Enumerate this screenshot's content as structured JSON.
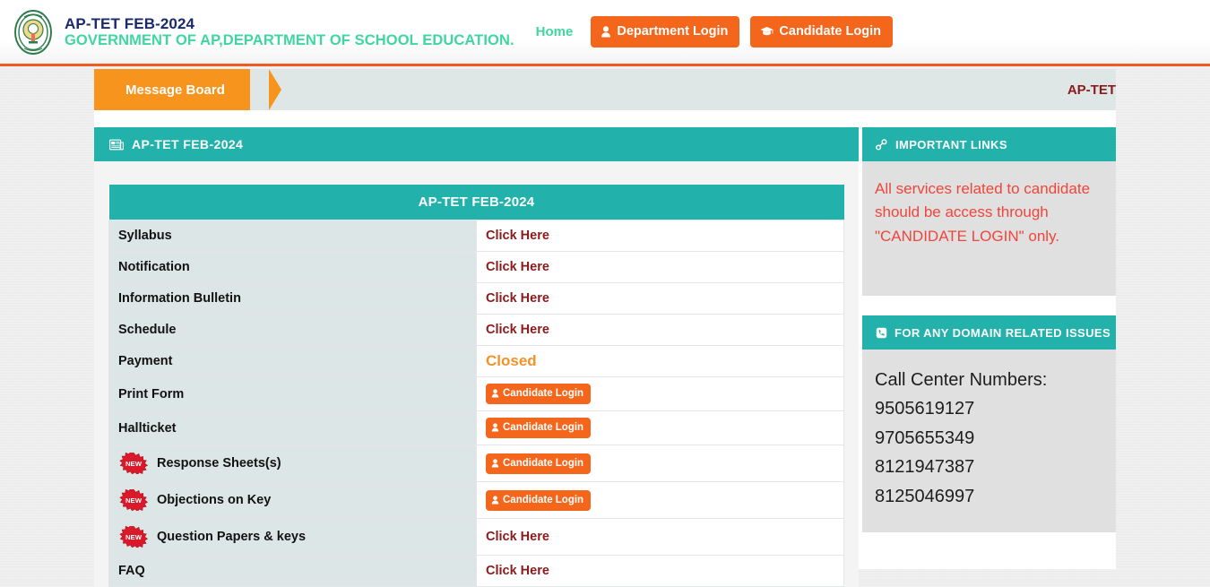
{
  "header": {
    "emblem_icon": "ap-government-emblem",
    "title": "AP-TET FEB-2024",
    "subtitle": "GOVERNMENT OF AP,DEPARTMENT OF SCHOOL EDUCATION.",
    "nav": {
      "home": "Home",
      "department_login": "Department Login",
      "department_login_icon": "user-icon",
      "candidate_login": "Candidate Login",
      "candidate_login_icon": "graduation-cap-icon"
    },
    "accent_orange": "#f4661b",
    "brand_navy": "#1a2a6c",
    "brand_green": "#3fd6a0"
  },
  "ribbon": {
    "tab_label": "Message Board",
    "right_label": "AP-TET",
    "tab_color": "#f7941e",
    "bar_color": "#dfe6e6",
    "right_label_color": "#8b1a1a"
  },
  "main": {
    "panel_title": "AP-TET FEB-2024",
    "panel_icon": "newspaper-icon",
    "panel_head_color": "#22b2ab",
    "table": {
      "header": "AP-TET FEB-2024",
      "rows": [
        {
          "label": "Syllabus",
          "new": false,
          "value_type": "link",
          "value": "Click Here"
        },
        {
          "label": "Notification",
          "new": false,
          "value_type": "link",
          "value": "Click Here"
        },
        {
          "label": "Information Bulletin",
          "new": false,
          "value_type": "link",
          "value": "Click Here"
        },
        {
          "label": "Schedule",
          "new": false,
          "value_type": "link",
          "value": "Click Here"
        },
        {
          "label": "Payment",
          "new": false,
          "value_type": "status",
          "value": "Closed"
        },
        {
          "label": "Print Form",
          "new": false,
          "value_type": "button",
          "value": "Candidate Login"
        },
        {
          "label": "Hallticket",
          "new": false,
          "value_type": "button",
          "value": "Candidate Login"
        },
        {
          "label": "Response Sheets(s)",
          "new": true,
          "value_type": "button",
          "value": "Candidate Login"
        },
        {
          "label": "Objections on Key",
          "new": true,
          "value_type": "button",
          "value": "Candidate Login"
        },
        {
          "label": "Question Papers & keys",
          "new": true,
          "value_type": "link",
          "value": "Click Here"
        },
        {
          "label": "FAQ",
          "new": false,
          "value_type": "link",
          "value": "Click Here"
        }
      ],
      "new_badge_label": "NEW",
      "link_color": "#8b1a1a",
      "closed_color": "#f4922a"
    }
  },
  "sidebar": {
    "important_links": {
      "title": "IMPORTANT LINKS",
      "icon": "link-chain-icon",
      "notice": "All services related to candidate should be access through \"CANDIDATE LOGIN\" only.",
      "notice_color": "#f0453a"
    },
    "domain_issues": {
      "title": "FOR ANY DOMAIN RELATED ISSUES",
      "icon": "phone-icon",
      "heading": "Call Center Numbers:",
      "numbers": [
        "9505619127",
        "9705655349",
        "8121947387",
        "8125046997"
      ]
    }
  }
}
